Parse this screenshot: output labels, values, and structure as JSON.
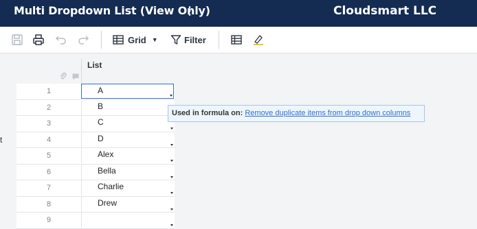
{
  "header": {
    "title": "Multi Dropdown List (View Only)",
    "kebab": "⋮",
    "org": "Cloudsmart LLC"
  },
  "toolbar": {
    "view_label": "Grid",
    "filter_label": "Filter"
  },
  "grid": {
    "column_title": "List",
    "rows": [
      {
        "num": "1",
        "value": "A"
      },
      {
        "num": "2",
        "value": "B"
      },
      {
        "num": "3",
        "value": "C"
      },
      {
        "num": "4",
        "value": "D"
      },
      {
        "num": "5",
        "value": "Alex"
      },
      {
        "num": "6",
        "value": "Bella"
      },
      {
        "num": "7",
        "value": "Charlie"
      },
      {
        "num": "8",
        "value": "Drew"
      },
      {
        "num": "9",
        "value": ""
      }
    ]
  },
  "tooltip": {
    "label": "Used in formula on:",
    "link": "Remove duplicate items from drop down columns"
  },
  "edge_text": "t",
  "colors": {
    "header_bg": "#142b52",
    "accent": "#2f6fd1",
    "tooltip_bg": "#eef6fc"
  }
}
